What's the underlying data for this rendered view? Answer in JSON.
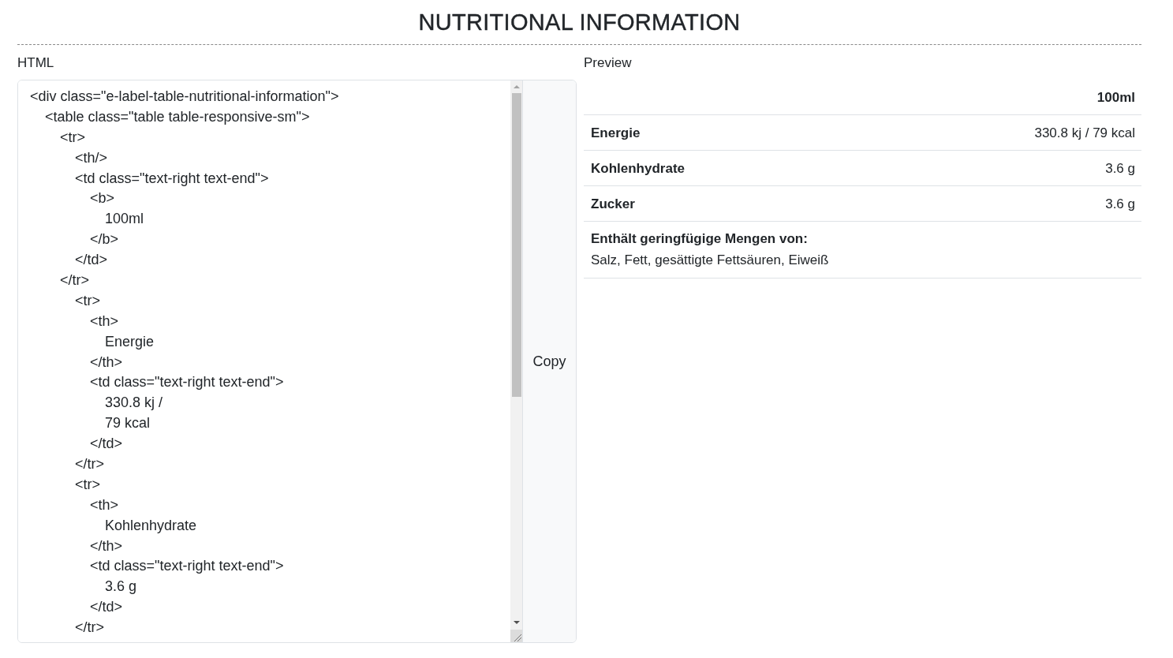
{
  "title": "NUTRITIONAL INFORMATION",
  "html_panel": {
    "label": "HTML",
    "code_lines": [
      {
        "text": "<div class=\"e-label-table-nutritional-information\">",
        "children": [
          {
            "text": "<table class=\"table table-responsive-sm\">",
            "children": [
              {
                "text": "<tr>",
                "children": [
                  {
                    "text": "<th/>"
                  },
                  {
                    "text": "<td class=\"text-right text-end\">",
                    "children": [
                      {
                        "text": "<b>",
                        "children": [
                          {
                            "text": "100ml"
                          }
                        ]
                      },
                      {
                        "text": "</b>"
                      }
                    ]
                  },
                  {
                    "text": "</td>"
                  }
                ]
              },
              {
                "text": "</tr>",
                "children": [
                  {
                    "text": "<tr>",
                    "children": [
                      {
                        "text": "<th>",
                        "children": [
                          {
                            "text": "Energie"
                          }
                        ]
                      },
                      {
                        "text": "</th>"
                      },
                      {
                        "text": "<td class=\"text-right text-end\">",
                        "children": [
                          {
                            "text": "330.8 kj /"
                          },
                          {
                            "text": "79 kcal"
                          }
                        ]
                      },
                      {
                        "text": "</td>"
                      }
                    ]
                  },
                  {
                    "text": "</tr>"
                  },
                  {
                    "text": "<tr>",
                    "children": [
                      {
                        "text": "<th>",
                        "children": [
                          {
                            "text": "Kohlenhydrate"
                          }
                        ]
                      },
                      {
                        "text": "</th>"
                      },
                      {
                        "text": "<td class=\"text-right text-end\">",
                        "children": [
                          {
                            "text": "3.6 g"
                          }
                        ]
                      },
                      {
                        "text": "</td>"
                      }
                    ]
                  },
                  {
                    "text": "</tr>"
                  }
                ]
              }
            ]
          }
        ]
      }
    ],
    "copy_button": "Copy"
  },
  "preview_panel": {
    "label": "Preview",
    "column_header": "100ml",
    "rows": [
      {
        "name": "Energie",
        "value": "330.8 kj / 79 kcal"
      },
      {
        "name": "Kohlenhydrate",
        "value": "3.6 g"
      },
      {
        "name": "Zucker",
        "value": "3.6 g"
      }
    ],
    "trace_note": {
      "heading": "Enthält geringfügige Mengen von:",
      "text": "Salz, Fett, gesättigte Fettsäuren, Eiweiß"
    }
  }
}
